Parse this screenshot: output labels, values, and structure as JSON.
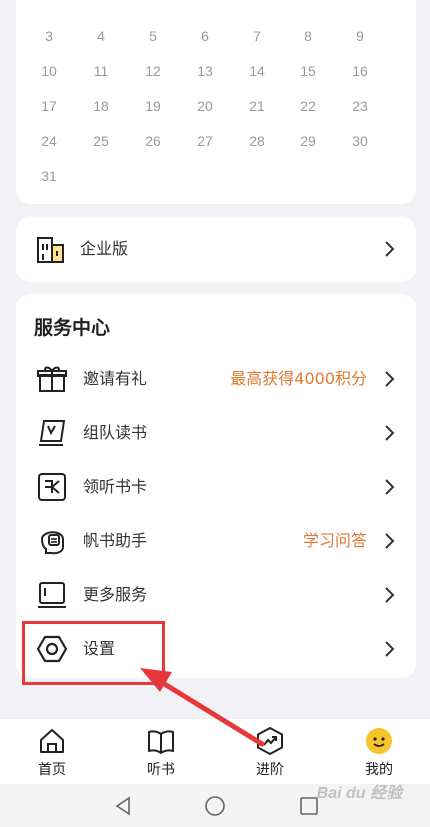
{
  "calendar": {
    "rows": [
      [
        "3",
        "4",
        "5",
        "6",
        "7",
        "8",
        "9"
      ],
      [
        "10",
        "11",
        "12",
        "13",
        "14",
        "15",
        "16"
      ],
      [
        "17",
        "18",
        "19",
        "20",
        "21",
        "22",
        "23"
      ],
      [
        "24",
        "25",
        "26",
        "27",
        "28",
        "29",
        "30"
      ],
      [
        "31"
      ]
    ]
  },
  "enterprise": {
    "label": "企业版",
    "icon": "building-icon"
  },
  "services": {
    "title": "服务中心",
    "items": [
      {
        "label": "邀请有礼",
        "extra": "最高获得4000积分",
        "icon": "gift-icon"
      },
      {
        "label": "组队读书",
        "extra": "",
        "icon": "flag-book-icon"
      },
      {
        "label": "领听书卡",
        "extra": "",
        "icon": "card-icon"
      },
      {
        "label": "帆书助手",
        "extra": "学习问答",
        "icon": "assistant-icon"
      },
      {
        "label": "更多服务",
        "extra": "",
        "icon": "more-services-icon"
      },
      {
        "label": "设置",
        "extra": "",
        "icon": "settings-hex-icon"
      }
    ]
  },
  "tabbar": {
    "tabs": [
      {
        "label": "首页",
        "icon": "home-icon"
      },
      {
        "label": "听书",
        "icon": "book-icon"
      },
      {
        "label": "进阶",
        "icon": "growth-icon"
      },
      {
        "label": "我的",
        "icon": "smiley-icon"
      }
    ]
  },
  "watermark": "Bai du 经验",
  "colors": {
    "accent_orange": "#e07a33",
    "annotation_red": "#e8393a",
    "smiley_yellow": "#f7c52b"
  }
}
